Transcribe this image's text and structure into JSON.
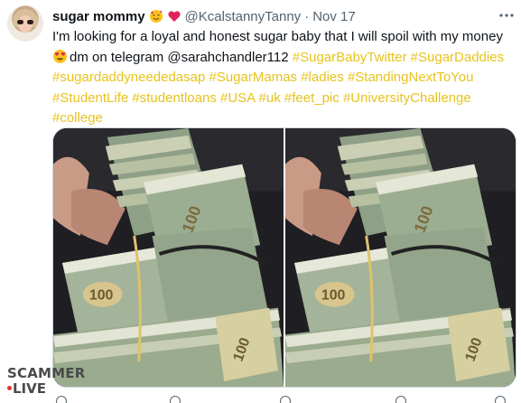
{
  "tweet": {
    "display_name": "sugar mommy",
    "name_emojis": [
      "smiling-face-with-hearts",
      "red-heart"
    ],
    "handle": "@KcalstannyTanny",
    "separator": "·",
    "date": "Nov 17",
    "more_icon": "ellipsis-icon",
    "text_line1": "I'm looking for a loyal and honest sugar baby that I will spoil with my money",
    "text_line2_emoji": "heart-eyes-emoji",
    "text_line2_plain": "dm on telegram @sarahchandler112 ",
    "hashtags_line2": [
      "#SugarBabyTwitter",
      "#SugarDaddies"
    ],
    "hashtags_line3": [
      "#sugardaddyneededasap",
      "#SugarMamas",
      "#ladies",
      "#StandingNextToYou"
    ],
    "hashtags_line4": [
      "#StudentLife",
      "#studentloans",
      "#USA",
      "#uk",
      "#feet_pic",
      "#UniversityChallenge"
    ],
    "hashtags_line5": [
      "#college"
    ],
    "hashtag_color": "#e8c31b"
  },
  "media": {
    "photo_count": 2,
    "photos": [
      {
        "subject": "stacks of 100 dollar bills held in hand"
      },
      {
        "subject": "stacks of 100 dollar bills held in hand"
      }
    ],
    "bill_label": "100"
  },
  "watermark": {
    "line1": "SCAMMER",
    "line2": "LIVE"
  }
}
